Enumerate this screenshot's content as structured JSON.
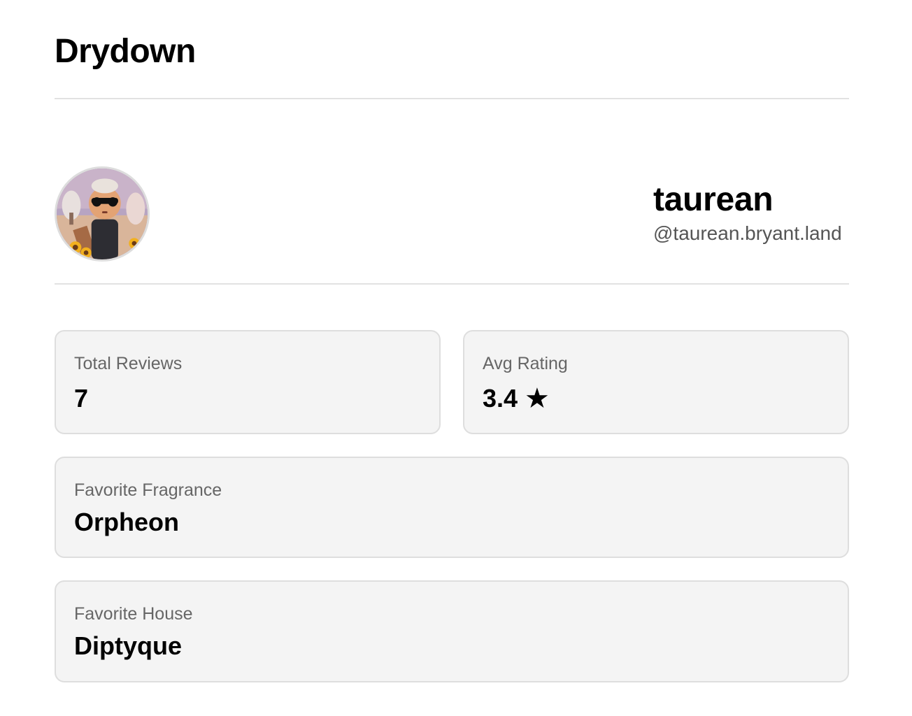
{
  "app": {
    "title": "Drydown"
  },
  "profile": {
    "display_name": "taurean",
    "handle": "@taurean.bryant.land",
    "avatar_icon": "user-avatar"
  },
  "stats": {
    "total_reviews": {
      "label": "Total Reviews",
      "value": "7"
    },
    "avg_rating": {
      "label": "Avg Rating",
      "value": "3.4",
      "star": "★",
      "star_icon": "star-icon"
    },
    "favorite_fragrance": {
      "label": "Favorite Fragrance",
      "value": "Orpheon"
    },
    "favorite_house": {
      "label": "Favorite House",
      "value": "Diptyque"
    }
  },
  "colors": {
    "card_background": "#f4f4f4",
    "card_border": "#dedede",
    "divider": "#e2e2e2",
    "muted_text": "#666666"
  }
}
